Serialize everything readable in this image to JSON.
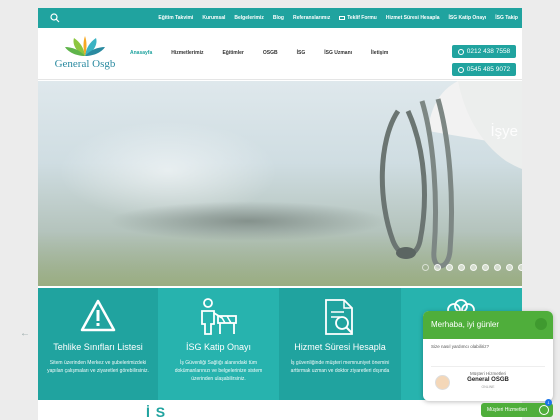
{
  "topbar": {
    "links": [
      "Eğitim Takvimi",
      "Kurumsal",
      "Belgelerimiz",
      "Blog",
      "Referanslarımız",
      "Teklif Formu",
      "Hizmet Süresi Hesapla",
      "İSG Katip Onayı",
      "İSG Takip"
    ]
  },
  "header": {
    "logo_text": "General Osgb",
    "nav": [
      "Anasayfa",
      "Hizmetlerimiz",
      "Eğitimler",
      "OSGB",
      "İSG",
      "İSG Uzmanı",
      "İletişim"
    ],
    "phone1": "0212 438 7558",
    "phone2": "0545 485 9072"
  },
  "hero": {
    "word": "İşye"
  },
  "services": [
    {
      "title": "Tehlike Sınıfları Listesi",
      "desc": "Sitem üzerinden Merkez ve şubelerimizdeki yapılan çalışmaları ve ziyaretleri görebilirsiniz."
    },
    {
      "title": "İSG Katip Onayı",
      "desc": "İş Güvenliği Sağlığı alanındaki tüm dokümanlarınızı ve belgelerinize sistem üzerinden ulaşabilirsiniz."
    },
    {
      "title": "Hizmet Süresi Hesapla",
      "desc": "İş güvenliğinde müşteri memnuniyet önemini arttırmak uzman ve doktor ziyaretleri dışında"
    },
    {
      "title": "",
      "desc": ""
    }
  ],
  "bottom": {
    "title": "İ    S       "
  },
  "chat": {
    "greeting": "Merhaba, iyi günler",
    "question": "Size nasıl yardımcı olabiliriz?",
    "agent_role": "Müşteri Hizmetleri",
    "agent_name": "General OSGB",
    "agent_status": "ONLINE",
    "button": "Müşteri Hizmetleri",
    "badge": "1"
  },
  "colors": {
    "primary": "#20a39f",
    "chat_green": "#4fae3b"
  }
}
